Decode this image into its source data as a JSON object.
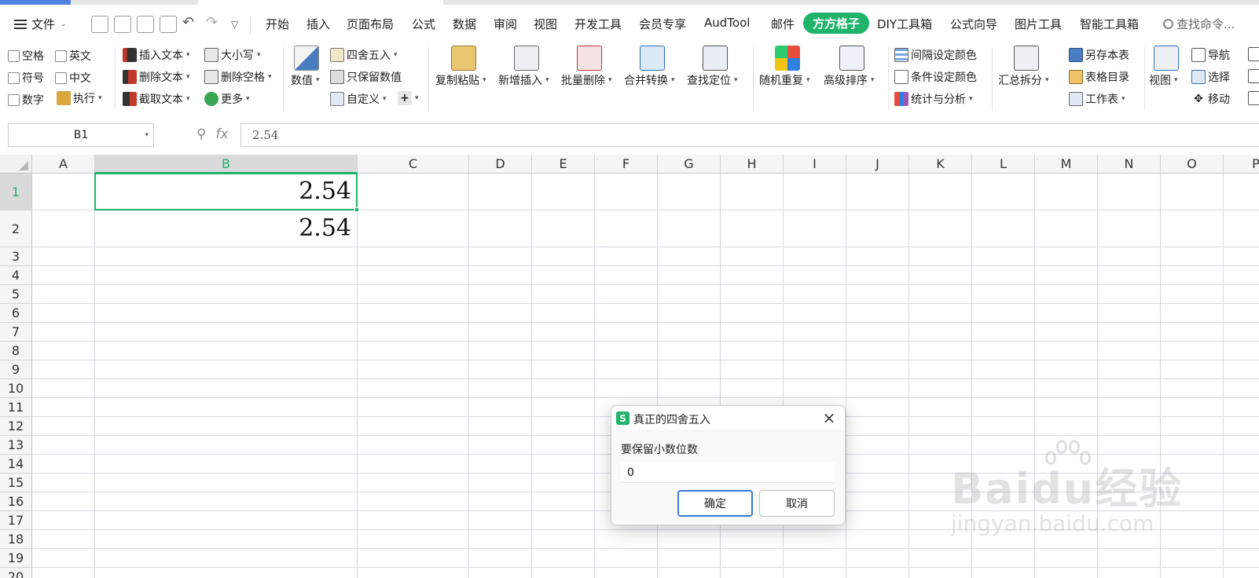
{
  "menubar": {
    "file_label": "文件",
    "tabs": [
      "开始",
      "插入",
      "页面布局",
      "公式",
      "数据",
      "审阅",
      "视图",
      "开发工具",
      "会员专享",
      "AudTool",
      "邮件",
      "方方格子",
      "DIY工具箱",
      "公式向导",
      "图片工具",
      "智能工具箱"
    ],
    "active_tab": "方方格子",
    "search_placeholder": "查找命令..."
  },
  "ribbon": {
    "checkboxes": [
      "空格",
      "英文",
      "符号",
      "中文",
      "数字"
    ],
    "execute": "执行",
    "text_group": [
      "插入文本",
      "删除文本",
      "截取文本"
    ],
    "case_group": [
      "大小写",
      "删除空格",
      "更多"
    ],
    "value_big": "数值",
    "round_group": [
      "四舍五入",
      "只保留数值",
      "自定义"
    ],
    "big_buttons": [
      "复制粘贴",
      "新增插入",
      "批量删除",
      "合并转换",
      "查找定位",
      "随机重复",
      "高级排序"
    ],
    "color_group": [
      "间隔设定颜色",
      "条件设定颜色",
      "统计与分析"
    ],
    "summary_big": "汇总拆分",
    "sheet_group": [
      "另存本表",
      "表格目录",
      "工作表"
    ],
    "view_big": "视图",
    "nav_group": [
      "导航",
      "选择",
      "移动"
    ]
  },
  "formula_bar": {
    "cell_ref": "B1",
    "fx": "fx",
    "value": "2.54"
  },
  "sheet": {
    "columns": [
      "A",
      "B",
      "C",
      "D",
      "E",
      "F",
      "G",
      "H",
      "I",
      "J",
      "K",
      "L",
      "M",
      "N",
      "O",
      "P"
    ],
    "rows": [
      "1",
      "2",
      "3",
      "4",
      "5",
      "6",
      "7",
      "8",
      "9",
      "10",
      "11",
      "12",
      "13",
      "14",
      "15",
      "16",
      "17",
      "18",
      "19",
      "20"
    ],
    "selected_cell": "B1",
    "cells": {
      "B1": "2.54",
      "B2": "2.54"
    }
  },
  "dialog": {
    "title": "真正的四舍五入",
    "app_icon": "S",
    "label": "要保留小数位数",
    "input_value": "0",
    "ok": "确定",
    "cancel": "取消"
  },
  "watermark": {
    "brand": "Baidu经验",
    "url": "jingyan.baidu.com"
  },
  "colors": {
    "accent_green": "#1fb36b",
    "primary_button_border": "#3b78d8"
  }
}
